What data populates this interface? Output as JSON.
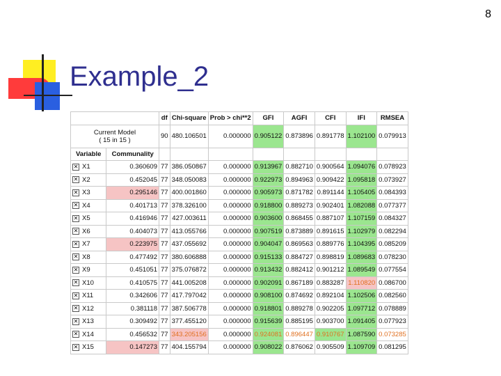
{
  "page_number": "8",
  "title": "Example_2",
  "table": {
    "headers": [
      "df",
      "Chi-square",
      "Prob > chi**2",
      "GFI",
      "AGFI",
      "CFI",
      "IFI",
      "RMSEA"
    ],
    "current_model": {
      "label_line1": "Current Model",
      "label_line2": "( 15 in 15 )",
      "values": [
        "90",
        "480.106501",
        "0.000000",
        "0.905122",
        "0.873896",
        "0.891778",
        "1.102100",
        "0.079913"
      ]
    },
    "variable_header": "Variable",
    "communality_header": "Communality",
    "rows": [
      {
        "name": "X1",
        "check": "✕",
        "communality": "0.360609",
        "df": "77",
        "chi": "386.050867",
        "prob": "0.000000",
        "gfi": "0.913967",
        "agfi": "0.882710",
        "cfi": "0.900564",
        "ifi": "1.094076",
        "rmsea": "0.078923"
      },
      {
        "name": "X2",
        "check": "✕",
        "communality": "0.452045",
        "df": "77",
        "chi": "348.050083",
        "prob": "0.000000",
        "gfi": "0.922973",
        "agfi": "0.894963",
        "cfi": "0.909422",
        "ifi": "1.095818",
        "rmsea": "0.073927"
      },
      {
        "name": "X3",
        "check": "✕",
        "communality": "0.295146",
        "df": "77",
        "chi": "400.001860",
        "prob": "0.000000",
        "gfi": "0.905973",
        "agfi": "0.871782",
        "cfi": "0.891144",
        "ifi": "1.105405",
        "rmsea": "0.084393"
      },
      {
        "name": "X4",
        "check": "✕",
        "communality": "0.401713",
        "df": "77",
        "chi": "378.326100",
        "prob": "0.000000",
        "gfi": "0.918800",
        "agfi": "0.889273",
        "cfi": "0.902401",
        "ifi": "1.082088",
        "rmsea": "0.077377"
      },
      {
        "name": "X5",
        "check": "✕",
        "communality": "0.416946",
        "df": "77",
        "chi": "427.003611",
        "prob": "0.000000",
        "gfi": "0.903600",
        "agfi": "0.868455",
        "cfi": "0.887107",
        "ifi": "1.107159",
        "rmsea": "0.084327"
      },
      {
        "name": "X6",
        "check": "✕",
        "communality": "0.404073",
        "df": "77",
        "chi": "413.055766",
        "prob": "0.000000",
        "gfi": "0.907519",
        "agfi": "0.873889",
        "cfi": "0.891615",
        "ifi": "1.102979",
        "rmsea": "0.082294"
      },
      {
        "name": "X7",
        "check": "✕",
        "communality": "0.223975",
        "df": "77",
        "chi": "437.055692",
        "prob": "0.000000",
        "gfi": "0.904047",
        "agfi": "0.869563",
        "cfi": "0.889776",
        "ifi": "1.104395",
        "rmsea": "0.085209"
      },
      {
        "name": "X8",
        "check": "✕",
        "communality": "0.477492",
        "df": "77",
        "chi": "380.606888",
        "prob": "0.000000",
        "gfi": "0.915133",
        "agfi": "0.884727",
        "cfi": "0.898819",
        "ifi": "1.089683",
        "rmsea": "0.078230"
      },
      {
        "name": "X9",
        "check": "✕",
        "communality": "0.451051",
        "df": "77",
        "chi": "375.076872",
        "prob": "0.000000",
        "gfi": "0.913432",
        "agfi": "0.882412",
        "cfi": "0.901212",
        "ifi": "1.089549",
        "rmsea": "0.077554"
      },
      {
        "name": "X10",
        "check": "✕",
        "communality": "0.410575",
        "df": "77",
        "chi": "441.005208",
        "prob": "0.000000",
        "gfi": "0.902091",
        "agfi": "0.867189",
        "cfi": "0.883287",
        "ifi": "1.110820",
        "rmsea": "0.086700"
      },
      {
        "name": "X11",
        "check": "✕",
        "communality": "0.342606",
        "df": "77",
        "chi": "417.797042",
        "prob": "0.000000",
        "gfi": "0.908100",
        "agfi": "0.874692",
        "cfi": "0.892104",
        "ifi": "1.102506",
        "rmsea": "0.082560"
      },
      {
        "name": "X12",
        "check": "✕",
        "communality": "0.381118",
        "df": "77",
        "chi": "387.506778",
        "prob": "0.000000",
        "gfi": "0.918801",
        "agfi": "0.889278",
        "cfi": "0.902205",
        "ifi": "1.097712",
        "rmsea": "0.078889"
      },
      {
        "name": "X13",
        "check": "✕",
        "communality": "0.309492",
        "df": "77",
        "chi": "377.455120",
        "prob": "0.000000",
        "gfi": "0.915639",
        "agfi": "0.885195",
        "cfi": "0.903700",
        "ifi": "1.091405",
        "rmsea": "0.077923"
      },
      {
        "name": "X14",
        "check": "✕",
        "communality": "0.456532",
        "df": "77",
        "chi": "343.205156",
        "prob": "0.000000",
        "gfi": "0.924081",
        "agfi": "0.896447",
        "cfi": "0.910767",
        "ifi": "1.087590",
        "rmsea": "0.073285"
      },
      {
        "name": "X15",
        "check": "✕",
        "communality": "0.147273",
        "df": "77",
        "chi": "404.155794",
        "prob": "0.000000",
        "gfi": "0.908022",
        "agfi": "0.876062",
        "cfi": "0.905509",
        "ifi": "1.109709",
        "rmsea": "0.081295"
      }
    ]
  }
}
